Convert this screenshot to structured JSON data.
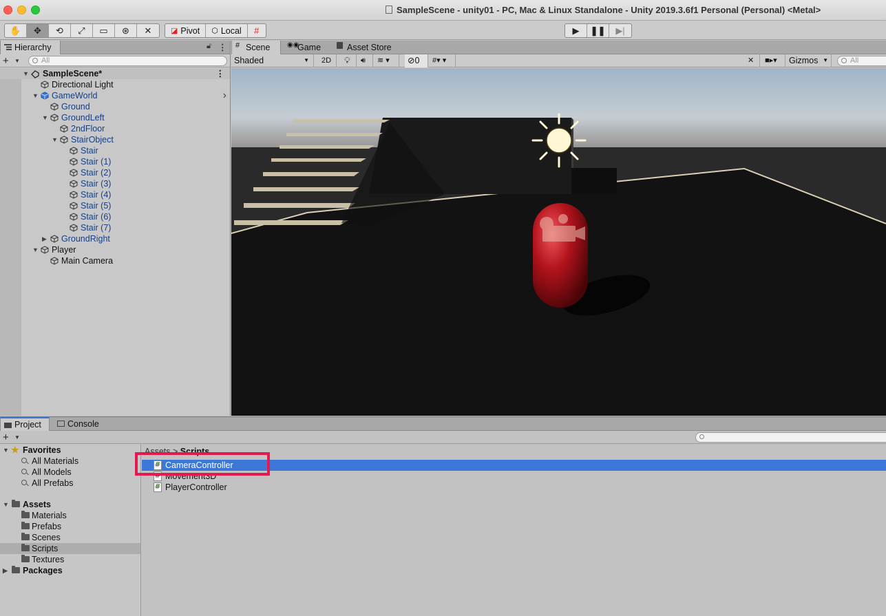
{
  "window": {
    "title": "SampleScene - unity01 - PC, Mac & Linux Standalone - Unity 2019.3.6f1 Personal (Personal) <Metal>"
  },
  "toolbar": {
    "pivot_label": "Pivot",
    "local_label": "Local"
  },
  "hierarchy": {
    "tab_label": "Hierarchy",
    "search_placeholder": "All",
    "scene_name": "SampleScene*",
    "items": [
      {
        "label": "Directional Light",
        "depth": 1,
        "arrow": "",
        "blue": false
      },
      {
        "label": "GameWorld",
        "depth": 1,
        "arrow": "down",
        "blue": true
      },
      {
        "label": "Ground",
        "depth": 2,
        "arrow": "",
        "blue": true
      },
      {
        "label": "GroundLeft",
        "depth": 2,
        "arrow": "down",
        "blue": true
      },
      {
        "label": "2ndFloor",
        "depth": 3,
        "arrow": "",
        "blue": true
      },
      {
        "label": "StairObject",
        "depth": 3,
        "arrow": "down",
        "blue": true
      },
      {
        "label": "Stair",
        "depth": 4,
        "arrow": "",
        "blue": true
      },
      {
        "label": "Stair (1)",
        "depth": 4,
        "arrow": "",
        "blue": true
      },
      {
        "label": "Stair (2)",
        "depth": 4,
        "arrow": "",
        "blue": true
      },
      {
        "label": "Stair (3)",
        "depth": 4,
        "arrow": "",
        "blue": true
      },
      {
        "label": "Stair (4)",
        "depth": 4,
        "arrow": "",
        "blue": true
      },
      {
        "label": "Stair (5)",
        "depth": 4,
        "arrow": "",
        "blue": true
      },
      {
        "label": "Stair (6)",
        "depth": 4,
        "arrow": "",
        "blue": true
      },
      {
        "label": "Stair (7)",
        "depth": 4,
        "arrow": "",
        "blue": true
      },
      {
        "label": "GroundRight",
        "depth": 2,
        "arrow": "right",
        "blue": true
      },
      {
        "label": "Player",
        "depth": 1,
        "arrow": "down",
        "blue": false
      },
      {
        "label": "Main Camera",
        "depth": 2,
        "arrow": "",
        "blue": false
      }
    ]
  },
  "scene_tabs": {
    "scene": "Scene",
    "game": "Game",
    "asset_store": "Asset Store"
  },
  "scene_bar": {
    "shading_mode": "Shaded",
    "mode_2d": "2D",
    "hidden_count": "0",
    "gizmos": "Gizmos",
    "search_placeholder": "All"
  },
  "project": {
    "tab_project": "Project",
    "tab_console": "Console",
    "favorites_label": "Favorites",
    "favorites": [
      "All Materials",
      "All Models",
      "All Prefabs"
    ],
    "assets_label": "Assets",
    "asset_folders": [
      "Materials",
      "Prefabs",
      "Scenes",
      "Scripts",
      "Textures"
    ],
    "selected_folder": "Scripts",
    "packages_label": "Packages",
    "breadcrumb_root": "Assets",
    "breadcrumb_sep": ">",
    "breadcrumb_current": "Scripts",
    "files": [
      "CameraController",
      "Movement3D",
      "PlayerController"
    ],
    "selected_file": "CameraController"
  },
  "colors": {
    "selection_blue": "#3d78d8",
    "highlight_box": "#e5194f",
    "prefab_blue": "#163f85",
    "player_capsule": "#b3131c"
  }
}
